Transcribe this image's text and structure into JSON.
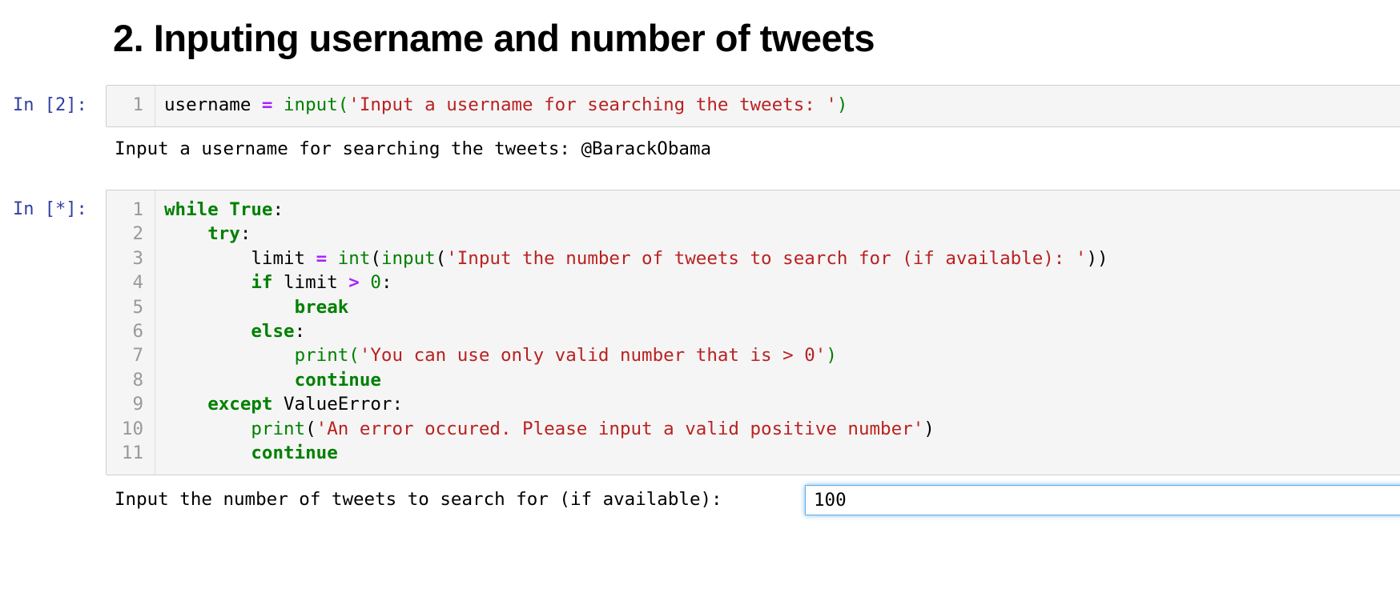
{
  "heading": "2. Inputing username and number of tweets",
  "cell1": {
    "prompt": "In [2]:",
    "lines": [
      {
        "n": "1",
        "tokens": [
          {
            "t": "tx",
            "v": "username "
          },
          {
            "t": "op",
            "v": "="
          },
          {
            "t": "tx",
            "v": " "
          },
          {
            "t": "bi",
            "v": "input"
          },
          {
            "t": "nm",
            "v": "("
          },
          {
            "t": "st",
            "v": "'Input a username for searching the tweets: '"
          },
          {
            "t": "nm",
            "v": ")"
          }
        ]
      }
    ],
    "output": "Input a username for searching the tweets: @BarackObama"
  },
  "cell2": {
    "prompt": "In [*]:",
    "lines": [
      {
        "n": "1",
        "tokens": [
          {
            "t": "kw",
            "v": "while"
          },
          {
            "t": "tx",
            "v": " "
          },
          {
            "t": "kw",
            "v": "True"
          },
          {
            "t": "tx",
            "v": ":"
          }
        ]
      },
      {
        "n": "2",
        "tokens": [
          {
            "t": "tx",
            "v": "    "
          },
          {
            "t": "kw",
            "v": "try"
          },
          {
            "t": "tx",
            "v": ":"
          }
        ]
      },
      {
        "n": "3",
        "tokens": [
          {
            "t": "tx",
            "v": "        limit "
          },
          {
            "t": "op",
            "v": "="
          },
          {
            "t": "tx",
            "v": " "
          },
          {
            "t": "bi",
            "v": "int"
          },
          {
            "t": "tx",
            "v": "("
          },
          {
            "t": "bi",
            "v": "input"
          },
          {
            "t": "tx",
            "v": "("
          },
          {
            "t": "st",
            "v": "'Input the number of tweets to search for (if available): '"
          },
          {
            "t": "tx",
            "v": "))"
          }
        ]
      },
      {
        "n": "4",
        "tokens": [
          {
            "t": "tx",
            "v": "        "
          },
          {
            "t": "kw",
            "v": "if"
          },
          {
            "t": "tx",
            "v": " limit "
          },
          {
            "t": "op",
            "v": ">"
          },
          {
            "t": "tx",
            "v": " "
          },
          {
            "t": "nm",
            "v": "0"
          },
          {
            "t": "tx",
            "v": ":"
          }
        ]
      },
      {
        "n": "5",
        "tokens": [
          {
            "t": "tx",
            "v": "            "
          },
          {
            "t": "kw",
            "v": "break"
          }
        ]
      },
      {
        "n": "6",
        "tokens": [
          {
            "t": "tx",
            "v": "        "
          },
          {
            "t": "kw",
            "v": "else"
          },
          {
            "t": "tx",
            "v": ":"
          }
        ]
      },
      {
        "n": "7",
        "tokens": [
          {
            "t": "tx",
            "v": "            "
          },
          {
            "t": "bi",
            "v": "print"
          },
          {
            "t": "nm",
            "v": "("
          },
          {
            "t": "st",
            "v": "'You can use only valid number that is > 0'"
          },
          {
            "t": "nm",
            "v": ")"
          }
        ]
      },
      {
        "n": "8",
        "tokens": [
          {
            "t": "tx",
            "v": "            "
          },
          {
            "t": "kw",
            "v": "continue"
          }
        ]
      },
      {
        "n": "9",
        "tokens": [
          {
            "t": "tx",
            "v": "    "
          },
          {
            "t": "kw",
            "v": "except"
          },
          {
            "t": "tx",
            "v": " ValueError:"
          }
        ]
      },
      {
        "n": "10",
        "tokens": [
          {
            "t": "tx",
            "v": "        "
          },
          {
            "t": "bi",
            "v": "print"
          },
          {
            "t": "tx",
            "v": "("
          },
          {
            "t": "st",
            "v": "'An error occured. Please input a valid positive number'"
          },
          {
            "t": "tx",
            "v": ")"
          }
        ]
      },
      {
        "n": "11",
        "tokens": [
          {
            "t": "tx",
            "v": "        "
          },
          {
            "t": "kw",
            "v": "continue"
          }
        ]
      }
    ],
    "output_prompt": "Input the number of tweets to search for (if available): ",
    "input_value": "100"
  }
}
